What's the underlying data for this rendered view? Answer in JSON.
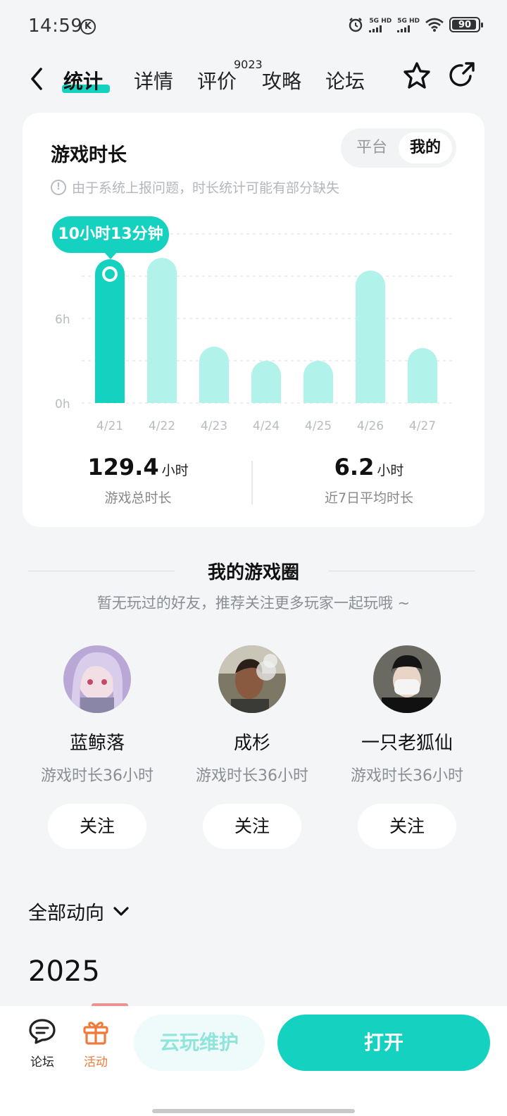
{
  "status_bar": {
    "time": "14:59",
    "k_badge": "K",
    "battery": "90",
    "signal_1": "5G HD",
    "signal_2": "5G HD"
  },
  "nav": {
    "tabs": [
      {
        "label": "统计"
      },
      {
        "label": "详情"
      },
      {
        "label": "评价"
      },
      {
        "label": "攻略"
      },
      {
        "label": "论坛"
      }
    ],
    "review_count": "9023"
  },
  "stats_card": {
    "title": "游戏时长",
    "segments": [
      "平台",
      "我的"
    ],
    "selected_segment": "我的",
    "notice": "由于系统上报问题，时长统计可能有部分缺失",
    "tooltip": "10小时13分钟",
    "total": {
      "value": "129.4",
      "unit": "小时",
      "caption": "游戏总时长"
    },
    "average": {
      "value": "6.2",
      "unit": "小时",
      "caption": "近7日平均时长"
    }
  },
  "chart_data": {
    "type": "bar",
    "categories": [
      "4/21",
      "4/22",
      "4/23",
      "4/24",
      "4/25",
      "4/26",
      "4/27"
    ],
    "values": [
      10.2,
      10.3,
      4.0,
      3.0,
      3.0,
      9.4,
      3.9
    ],
    "selected_index": 0,
    "y_ticks": [
      "0h",
      "6h"
    ],
    "y_tick_values": [
      0,
      6
    ],
    "ylim": [
      0,
      12
    ],
    "grid": true,
    "colors": {
      "selected": "#14d2bf",
      "default": "#b1f2ea"
    }
  },
  "game_circle": {
    "title": "我的游戏圈",
    "subtitle": "暂无玩过的好友，推荐关注更多玩家一起玩哦 ~",
    "friends": [
      {
        "name": "蓝鲸落",
        "duration": "游戏时长36小时",
        "follow": "关注"
      },
      {
        "name": "成杉",
        "duration": "游戏时长36小时",
        "follow": "关注"
      },
      {
        "name": "一只老狐仙",
        "duration": "游戏时长36小时",
        "follow": "关注"
      }
    ]
  },
  "feed": {
    "filter_label": "全部动向",
    "year": "2025"
  },
  "bottom_bar": {
    "forum_label": "论坛",
    "activity_label": "活动",
    "cloud_label": "云玩维护",
    "open_label": "打开"
  },
  "colors": {
    "accent": "#14d2bf",
    "accent_light": "#b1f2ea",
    "activity": "#f07a3c"
  }
}
